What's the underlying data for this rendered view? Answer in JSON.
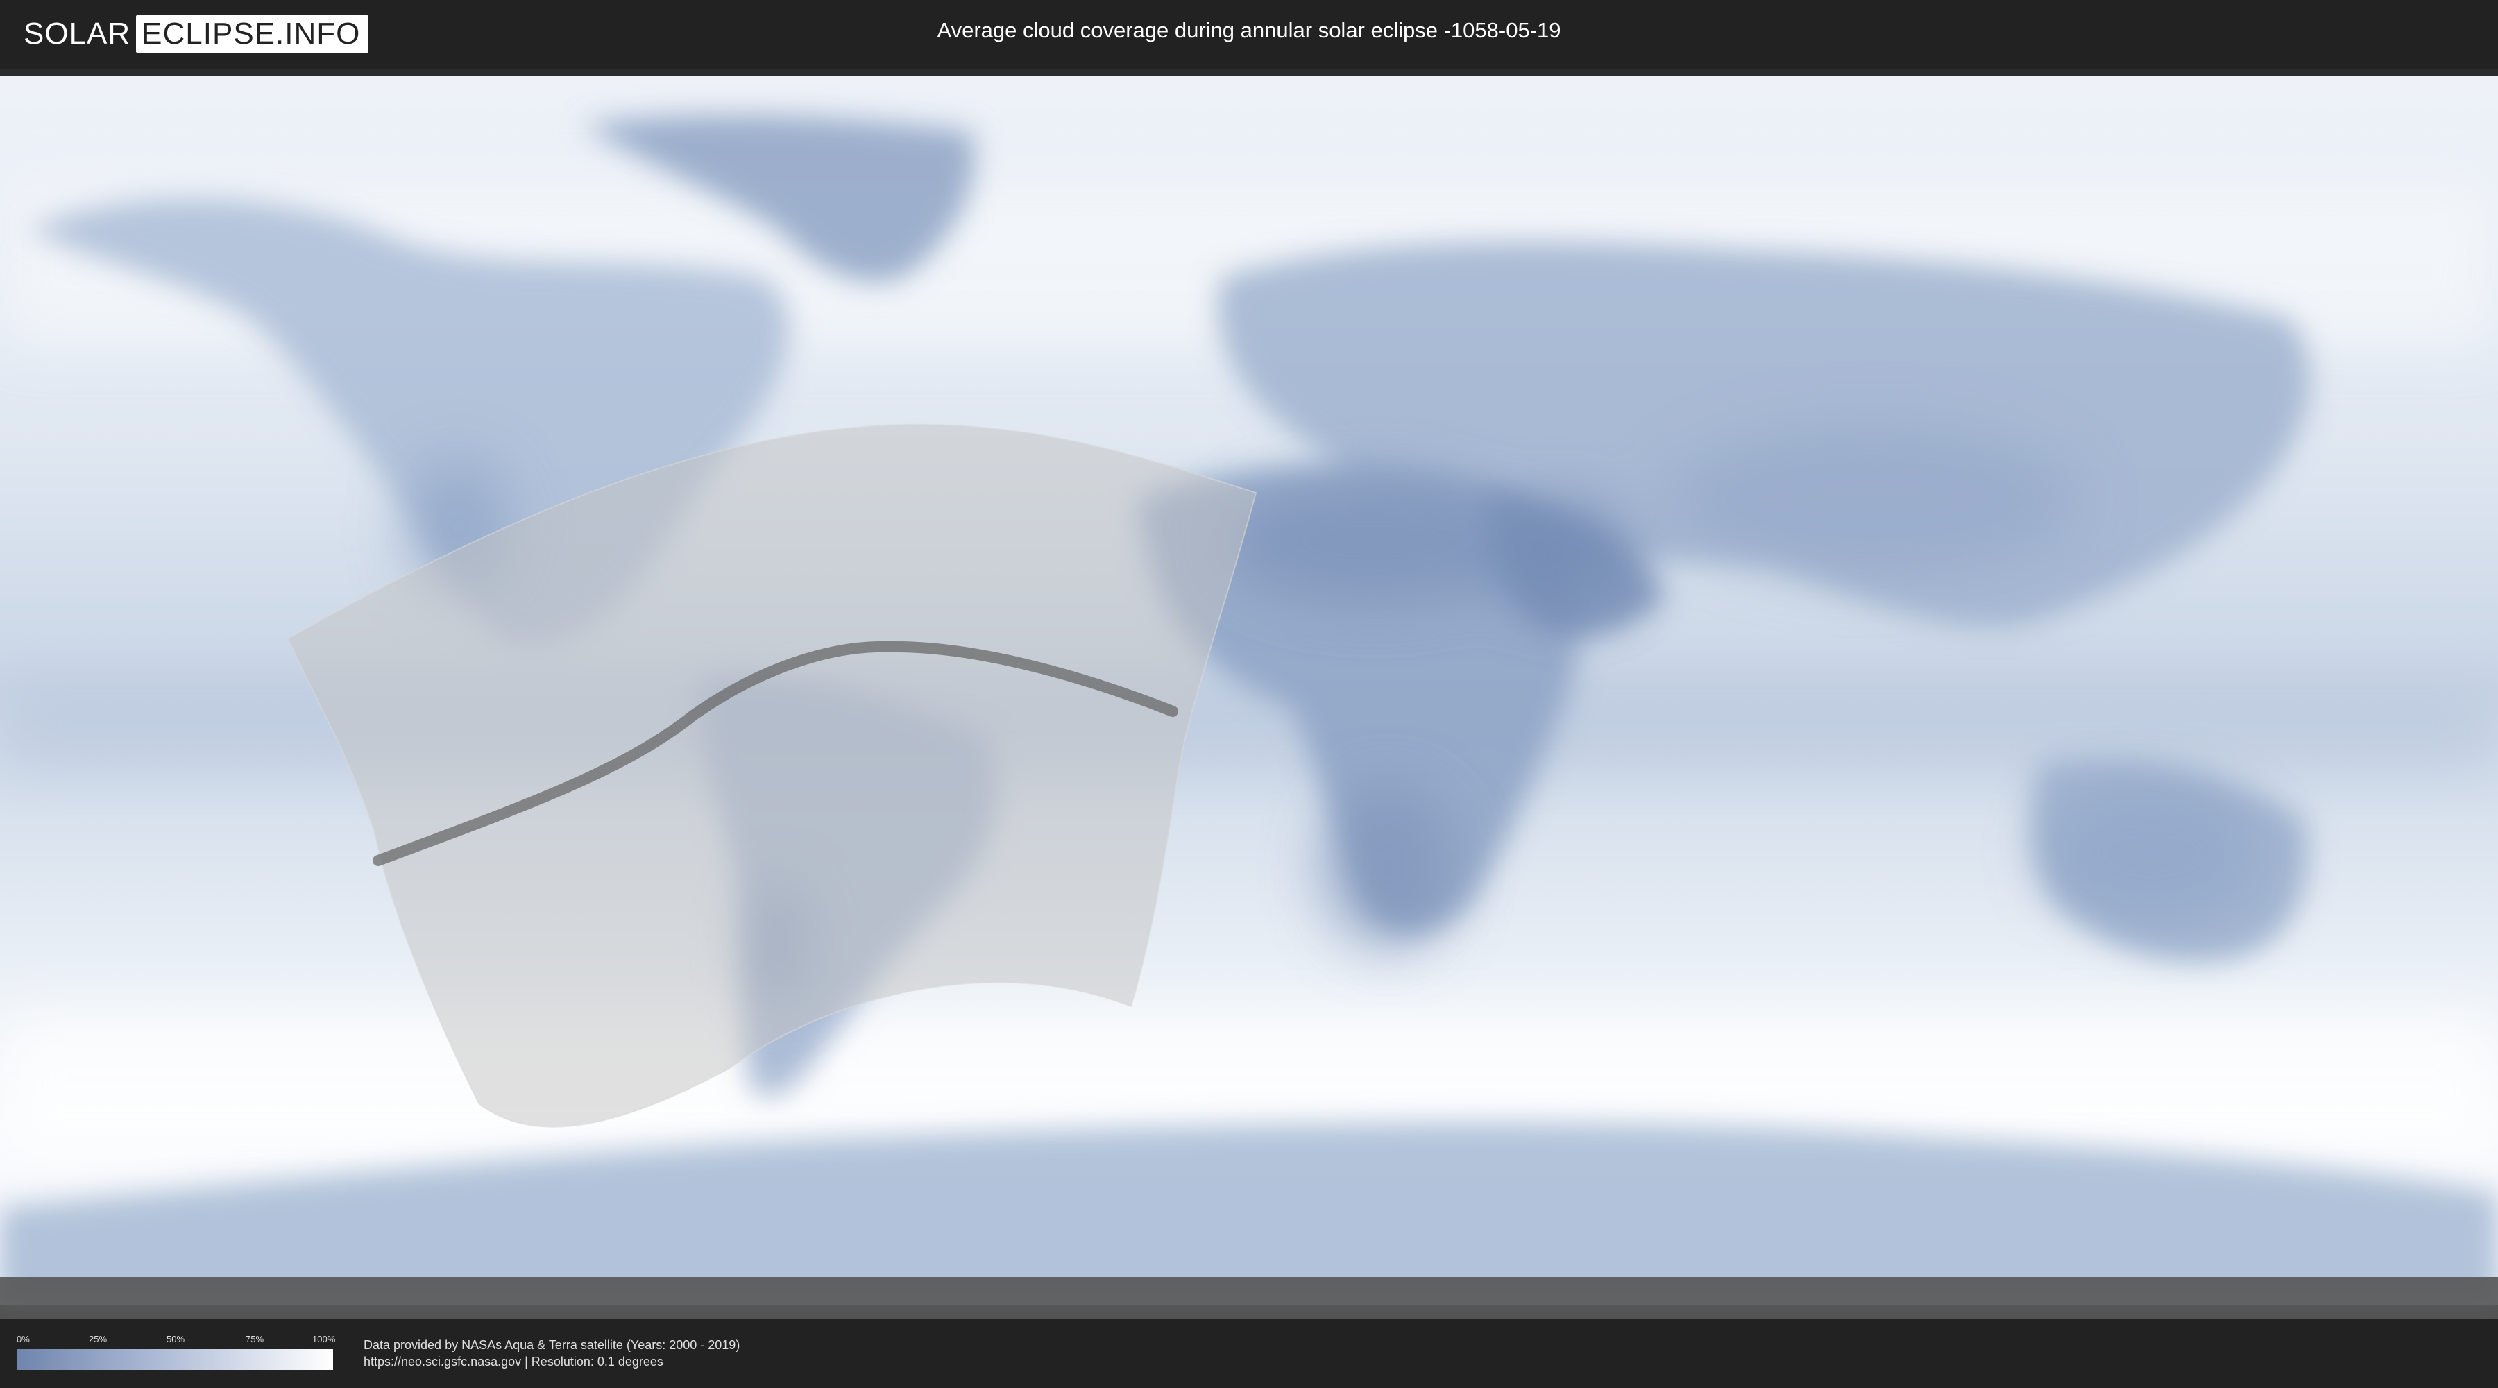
{
  "logo": {
    "left": "SOLAR",
    "right": "ECLIPSE.INFO"
  },
  "title": "Average cloud coverage during annular solar eclipse -1058-05-19",
  "legend": {
    "ticks": [
      "0%",
      "25%",
      "50%",
      "75%",
      "100%"
    ],
    "color_low": "#6f85ad",
    "color_high": "#ffffff"
  },
  "credits": {
    "line1": "Data provided by NASAs Aqua & Terra satellite (Years: 2000 - 2019)",
    "line2": "https://neo.sci.gsfc.nasa.gov | Resolution: 0.1 degrees"
  },
  "colors": {
    "bar_background": "#222222",
    "cloud_clear": "#ffffff",
    "cloud_dense": "#6f85ad",
    "eclipse_zone": "#bdbdbd",
    "central_line": "#6a6a6a"
  }
}
